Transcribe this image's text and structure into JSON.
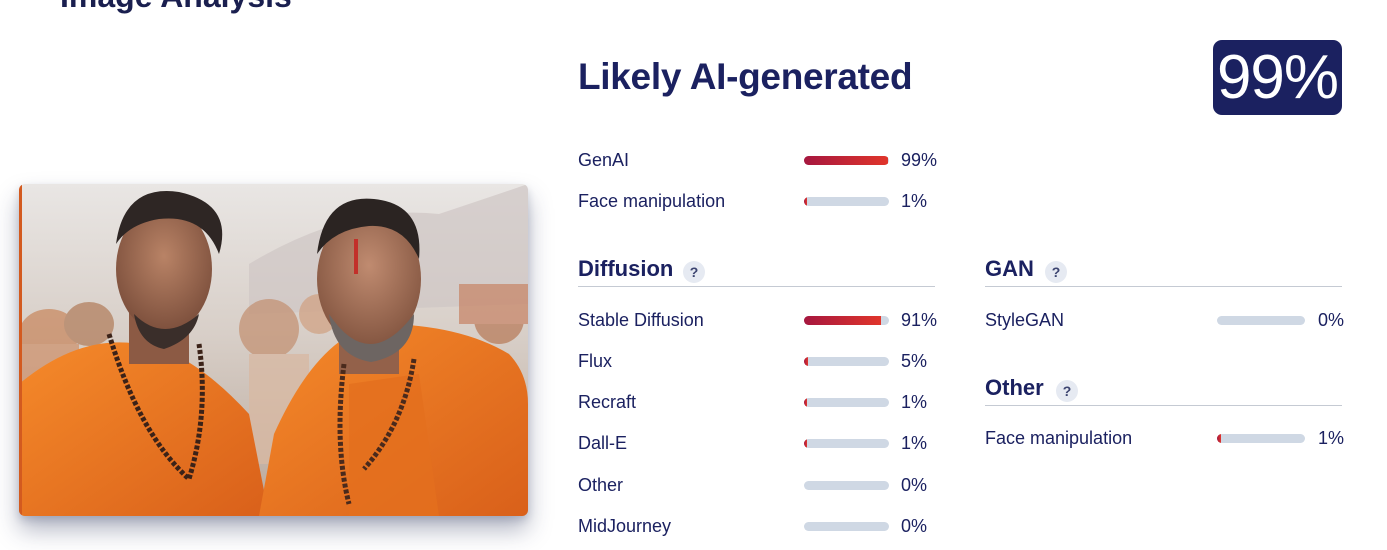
{
  "page": {
    "cut_off_heading": "Image Analysis"
  },
  "result": {
    "verdict": "Likely AI-generated",
    "score": "99%"
  },
  "summary": [
    {
      "label": "GenAI",
      "value": 0.99,
      "display": "99%"
    },
    {
      "label": "Face manipulation",
      "value": 0.01,
      "display": "1%"
    }
  ],
  "diffusion": {
    "title": "Diffusion",
    "help": "?",
    "items": [
      {
        "label": "Stable Diffusion",
        "value": 0.91,
        "display": "91%"
      },
      {
        "label": "Flux",
        "value": 0.05,
        "display": "5%"
      },
      {
        "label": "Recraft",
        "value": 0.01,
        "display": "1%"
      },
      {
        "label": "Dall-E",
        "value": 0.01,
        "display": "1%"
      },
      {
        "label": "Other",
        "value": 0.0,
        "display": "0%"
      },
      {
        "label": "MidJourney",
        "value": 0.0,
        "display": "0%"
      }
    ]
  },
  "gan": {
    "title": "GAN",
    "help": "?",
    "items": [
      {
        "label": "StyleGAN",
        "value": 0.0,
        "display": "0%"
      }
    ]
  },
  "other": {
    "title": "Other",
    "help": "?",
    "items": [
      {
        "label": "Face manipulation",
        "value": 0.01,
        "display": "1%"
      }
    ]
  },
  "colors": {
    "navy": "#1b2160",
    "bar_track": "#cfd8e4",
    "bar_fill_start": "#a6173f",
    "bar_fill_end": "#e0352b"
  }
}
